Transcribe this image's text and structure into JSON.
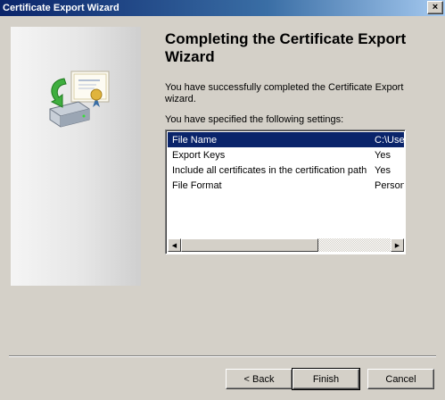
{
  "window": {
    "title": "Certificate Export Wizard",
    "close_glyph": "×"
  },
  "banner": {
    "icon": "certificate-export-icon"
  },
  "content": {
    "heading": "Completing the Certificate Export Wizard",
    "success_text": "You have successfully completed the Certificate Export wizard.",
    "settings_label": "You have specified the following settings:"
  },
  "settings": {
    "rows": [
      {
        "name": "File Name",
        "value": "C:\\Users",
        "selected": true
      },
      {
        "name": "Export Keys",
        "value": "Yes",
        "selected": false
      },
      {
        "name": "Include all certificates in the certification path",
        "value": "Yes",
        "selected": false
      },
      {
        "name": "File Format",
        "value": "Personal",
        "selected": false
      }
    ],
    "scroll_left_glyph": "◀",
    "scroll_right_glyph": "▶"
  },
  "buttons": {
    "back": "< Back",
    "finish": "Finish",
    "cancel": "Cancel"
  },
  "colors": {
    "titlebar_start": "#0a246a",
    "selection": "#0a246a",
    "face": "#d4d0c8"
  }
}
